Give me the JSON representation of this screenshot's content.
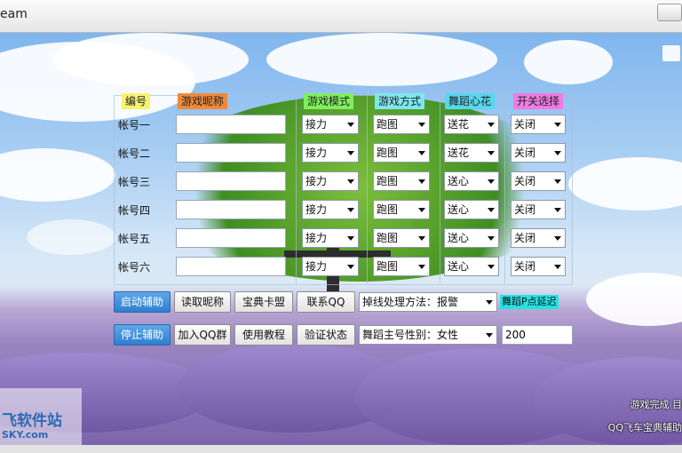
{
  "window": {
    "title": "eam"
  },
  "headers": {
    "id": "编号",
    "nickname": "游戏昵称",
    "mode": "游戏模式",
    "method": "游戏方式",
    "flower": "舞蹈心花",
    "toggle": "开关选择"
  },
  "header_colors": {
    "id": "#f7f271",
    "nickname": "#f08a3a",
    "mode": "#80ef5d",
    "method": "#7ee7f0",
    "flower": "#57d7ec",
    "toggle": "#f07ae6"
  },
  "accounts": [
    {
      "label": "帐号一",
      "nickname": "",
      "mode": "接力",
      "method": "跑图",
      "flower": "送花",
      "toggle": "关闭"
    },
    {
      "label": "帐号二",
      "nickname": "",
      "mode": "接力",
      "method": "跑图",
      "flower": "送花",
      "toggle": "关闭"
    },
    {
      "label": "帐号三",
      "nickname": "",
      "mode": "接力",
      "method": "跑图",
      "flower": "送心",
      "toggle": "关闭"
    },
    {
      "label": "帐号四",
      "nickname": "",
      "mode": "接力",
      "method": "跑图",
      "flower": "送心",
      "toggle": "关闭"
    },
    {
      "label": "帐号五",
      "nickname": "",
      "mode": "接力",
      "method": "跑图",
      "flower": "送心",
      "toggle": "关闭"
    },
    {
      "label": "帐号六",
      "nickname": "",
      "mode": "接力",
      "method": "跑图",
      "flower": "送心",
      "toggle": "关闭"
    }
  ],
  "buttons": {
    "start": "启动辅助",
    "read_nick": "读取昵称",
    "card": "宝典卡盟",
    "contact_qq": "联系QQ",
    "stop": "停止辅助",
    "join_qq": "加入QQ群",
    "tutorial": "使用教程",
    "verify": "验证状态"
  },
  "disconnect": {
    "value": "掉线处理方法：报警"
  },
  "gender": {
    "value": "舞蹈主号性别：女性"
  },
  "delay": {
    "label": "舞蹈P点延迟",
    "value": "200"
  },
  "logo": {
    "line1": "飞软件站",
    "line2": "SKY.com"
  },
  "status": {
    "line1": "游戏完成 目",
    "line2": "QQ飞车宝典辅助"
  }
}
